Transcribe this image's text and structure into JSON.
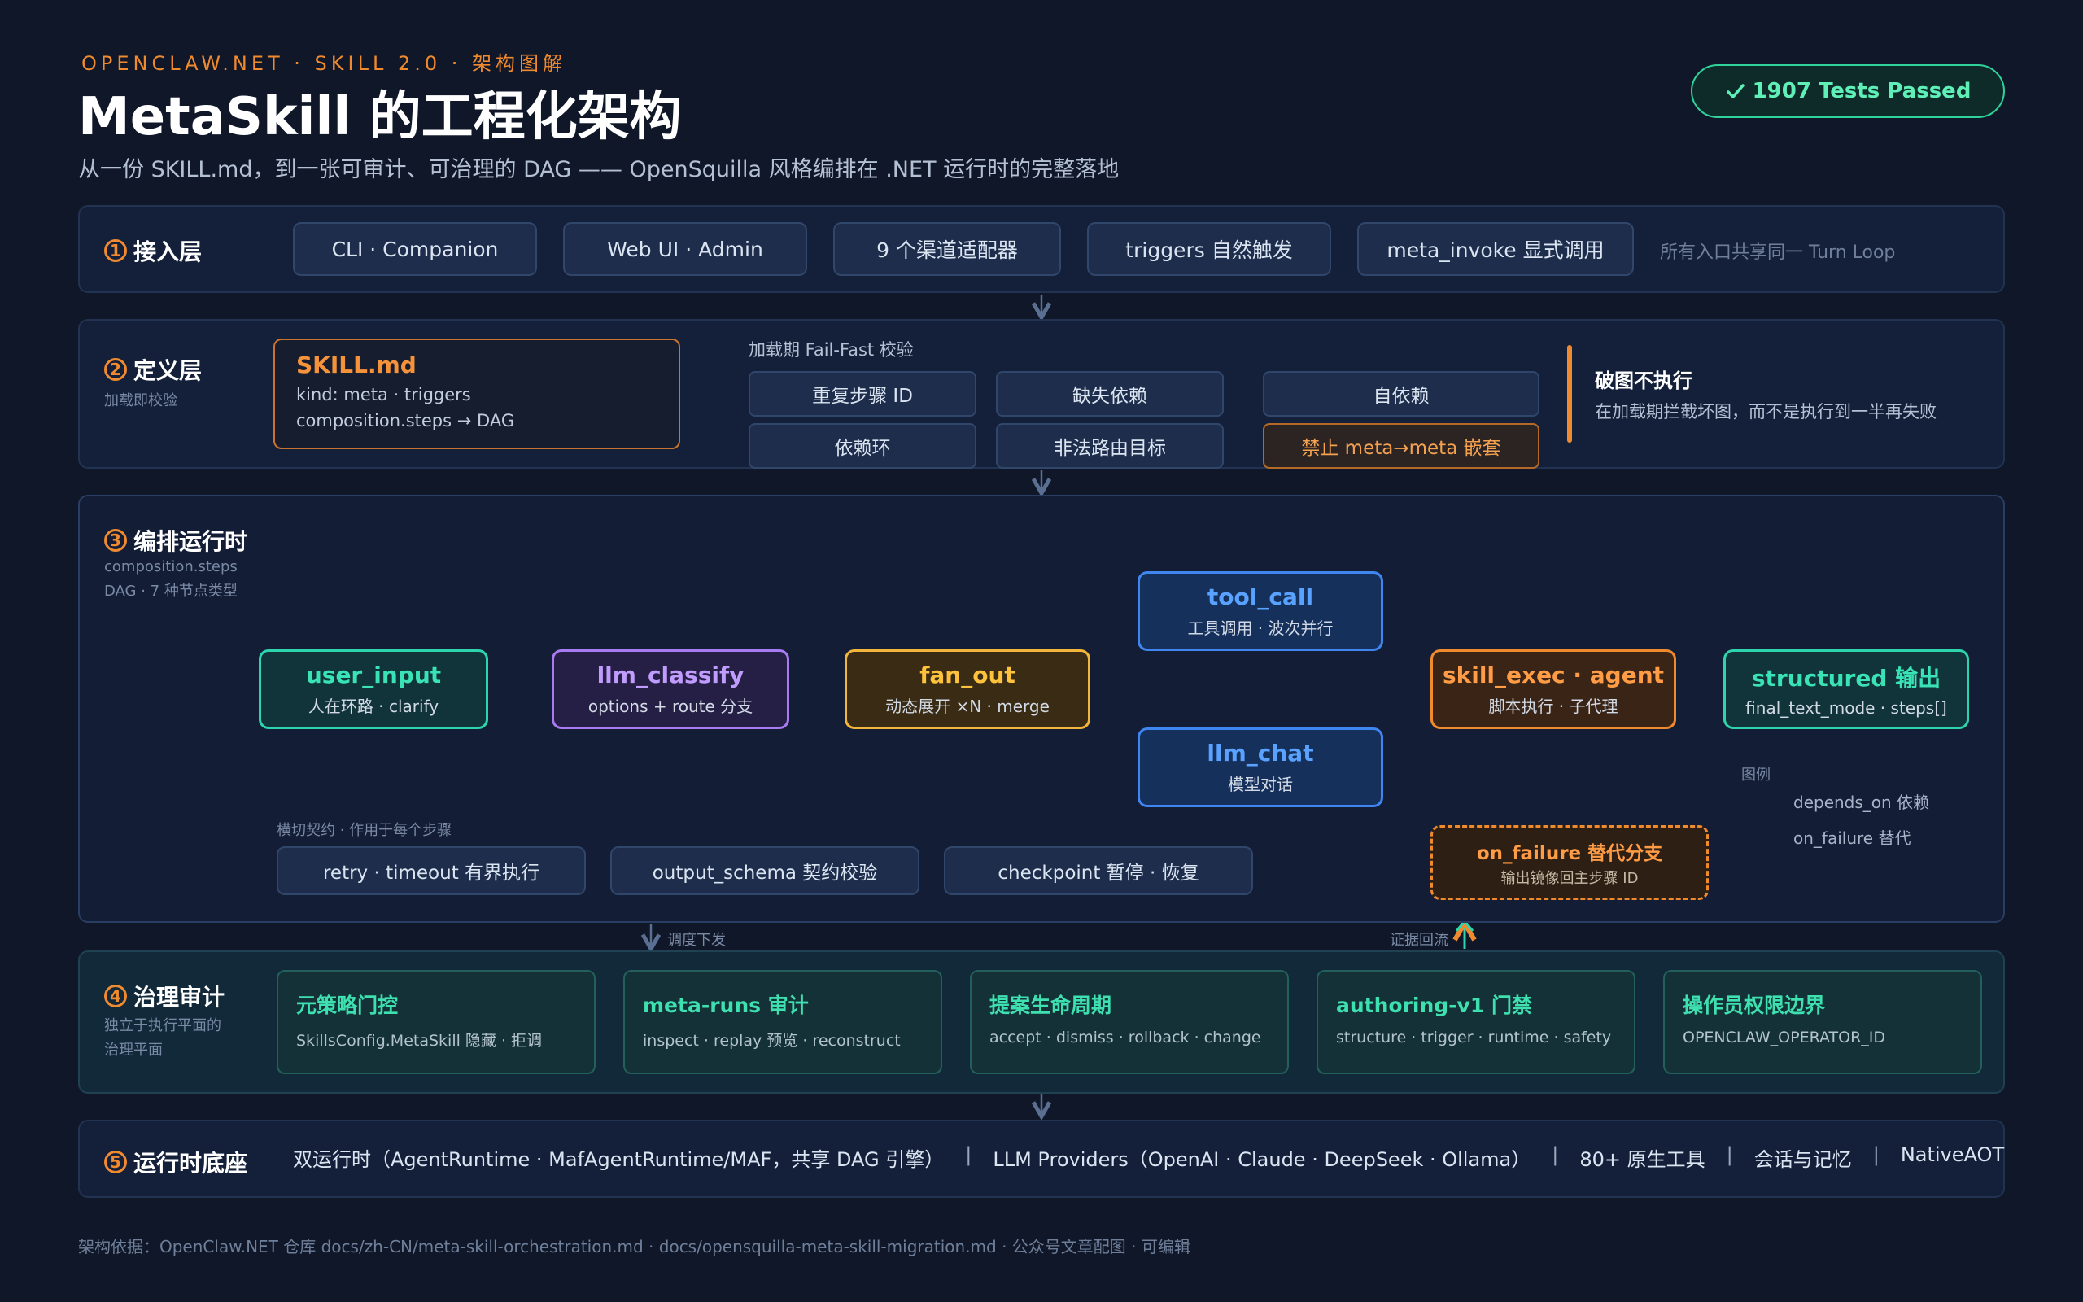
{
  "header": {
    "brand": "OPENCLAW.NET · SKILL 2.0 · 架构图解",
    "title": "MetaSkill 的工程化架构",
    "subtitle": "从一份 SKILL.md，到一张可审计、可治理的 DAG —— OpenSquilla 风格编排在 .NET 运行时的完整落地",
    "badge_icon": "check-icon",
    "badge": "1907 Tests Passed"
  },
  "layer1": {
    "num": "1",
    "title": "接入层",
    "items": [
      "CLI · Companion",
      "Web UI · Admin",
      "9 个渠道适配器",
      "triggers 自然触发",
      "meta_invoke 显式调用"
    ],
    "note": "所有入口共享同一 Turn Loop"
  },
  "layer2": {
    "num": "2",
    "title": "定义层",
    "sub": "加载即校验",
    "skill": {
      "title": "SKILL.md",
      "line1": "kind: meta · triggers",
      "line2": "composition.steps → DAG"
    },
    "checks_label": "加载期 Fail-Fast 校验",
    "checks": [
      "重复步骤 ID",
      "缺失依赖",
      "自依赖",
      "依赖环",
      "非法路由目标",
      "禁止 meta→meta 嵌套"
    ],
    "callout_title": "破图不执行",
    "callout_text": "在加载期拦截坏图，而不是执行到一半再失败"
  },
  "layer3": {
    "num": "3",
    "title": "编排运行时",
    "sub1": "composition.steps",
    "sub2": "DAG · 7 种节点类型",
    "nodes": {
      "user_input": {
        "title": "user_input",
        "sub": "人在环路 · clarify"
      },
      "llm_classify": {
        "title": "llm_classify",
        "sub": "options + route 分支"
      },
      "fan_out": {
        "title": "fan_out",
        "sub": "动态展开 ×N · merge"
      },
      "tool_call": {
        "title": "tool_call",
        "sub": "工具调用 · 波次并行"
      },
      "llm_chat": {
        "title": "llm_chat",
        "sub": "模型对话"
      },
      "skill_exec": {
        "title": "skill_exec · agent",
        "sub": "脚本执行 · 子代理"
      },
      "structured": {
        "title": "structured 输出",
        "sub": "final_text_mode · steps[]"
      },
      "on_failure": {
        "title": "on_failure 替代分支",
        "sub": "输出镜像回主步骤 ID"
      }
    },
    "contracts_label": "横切契约 · 作用于每个步骤",
    "contracts": [
      "retry · timeout 有界执行",
      "output_schema 契约校验",
      "checkpoint 暂停 · 恢复"
    ],
    "legend": {
      "title": "图例",
      "depends": "depends_on 依赖",
      "failure": "on_failure 替代"
    }
  },
  "flow": {
    "down": "调度下发",
    "up": "证据回流"
  },
  "layer4": {
    "num": "4",
    "title": "治理审计",
    "sub1": "独立于执行平面的",
    "sub2": "治理平面",
    "cards": [
      {
        "title": "元策略门控",
        "sub": "SkillsConfig.MetaSkill 隐藏 · 拒调"
      },
      {
        "title": "meta-runs 审计",
        "sub": "inspect · replay 预览 · reconstruct"
      },
      {
        "title": "提案生命周期",
        "sub": "accept · dismiss · rollback · change"
      },
      {
        "title": "authoring-v1 门禁",
        "sub": "structure · trigger · runtime · safety"
      },
      {
        "title": "操作员权限边界",
        "sub": "OPENCLAW_OPERATOR_ID"
      }
    ]
  },
  "layer5": {
    "num": "5",
    "title": "运行时底座",
    "items": [
      "双运行时（AgentRuntime · MafAgentRuntime/MAF，共享 DAG 引擎）",
      "LLM Providers（OpenAI · Claude · DeepSeek · Ollama）",
      "80+ 原生工具",
      "会话与记忆",
      "NativeAOT"
    ],
    "separator": "|"
  },
  "footer": "架构依据：OpenClaw.NET 仓库 docs/zh-CN/meta-skill-orchestration.md · docs/opensquilla-meta-skill-migration.md    ·    公众号文章配图 · 可编辑",
  "colors": {
    "background": "#0f1728",
    "accent_orange": "#f08a2f",
    "teal": "#2ed4ac",
    "purple": "#a97bf2",
    "yellow": "#f2b63a",
    "blue": "#3f86f0",
    "edge": "#4a5f82"
  }
}
